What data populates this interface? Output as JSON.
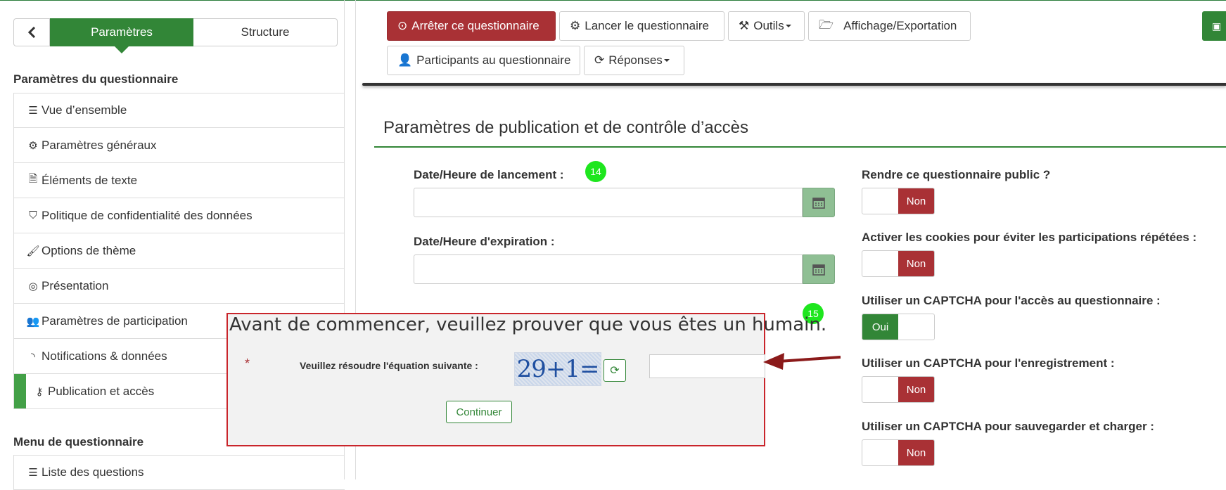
{
  "sidebar": {
    "tab_params": "Paramètres",
    "tab_structure": "Structure",
    "section_title": "Paramètres du questionnaire",
    "items": [
      {
        "label": "Vue d’ensemble",
        "icon": "list-icon"
      },
      {
        "label": "Paramètres généraux",
        "icon": "gears-icon"
      },
      {
        "label": "Éléments de texte",
        "icon": "document-icon"
      },
      {
        "label": "Politique de confidentialité des données",
        "icon": "shield-icon"
      },
      {
        "label": "Options de thème",
        "icon": "paintbrush-icon"
      },
      {
        "label": "Présentation",
        "icon": "eye-slash-icon"
      },
      {
        "label": "Paramètres de participation",
        "icon": "users-icon"
      },
      {
        "label": "Notifications & données",
        "icon": "rss-icon"
      },
      {
        "label": "Publication et accès",
        "icon": "key-icon",
        "active": true
      }
    ],
    "menu_title": "Menu de questionnaire",
    "menu_items": [
      {
        "label": "Liste des questions",
        "icon": "list-icon"
      }
    ]
  },
  "toolbar": {
    "stop": "Arrêter ce questionnaire",
    "launch": "Lancer le questionnaire",
    "tools": "Outils",
    "display_export": "Affichage/Exportation",
    "participants": "Participants au questionnaire",
    "responses": "Réponses"
  },
  "main": {
    "title": "Paramètres de publication et de contrôle d’accès",
    "start_label": "Date/Heure de lancement :",
    "expiry_label": "Date/Heure d'expiration :",
    "badge_14": "14",
    "badge_15": "15",
    "options": [
      {
        "label": "Rendre ce questionnaire public ?",
        "value": "Non"
      },
      {
        "label": "Activer les cookies pour éviter les participations répétées :",
        "value": "Non"
      },
      {
        "label": "Utiliser un CAPTCHA pour l'accès au questionnaire :",
        "value": "Oui"
      },
      {
        "label": "Utiliser un CAPTCHA pour l'enregistrement :",
        "value": "Non"
      },
      {
        "label": "Utiliser un CAPTCHA pour sauvegarder et charger :",
        "value": "Non"
      }
    ]
  },
  "captcha": {
    "title": "Avant de commencer, veuillez prouver que vous êtes un humain.",
    "required_mark": "*",
    "prompt": "Veuillez résoudre l'équation suivante :",
    "image_text": "29+1=",
    "continue": "Continuer"
  },
  "colors": {
    "green": "#328637",
    "red": "#a93135",
    "badge": "#1ee61e"
  }
}
